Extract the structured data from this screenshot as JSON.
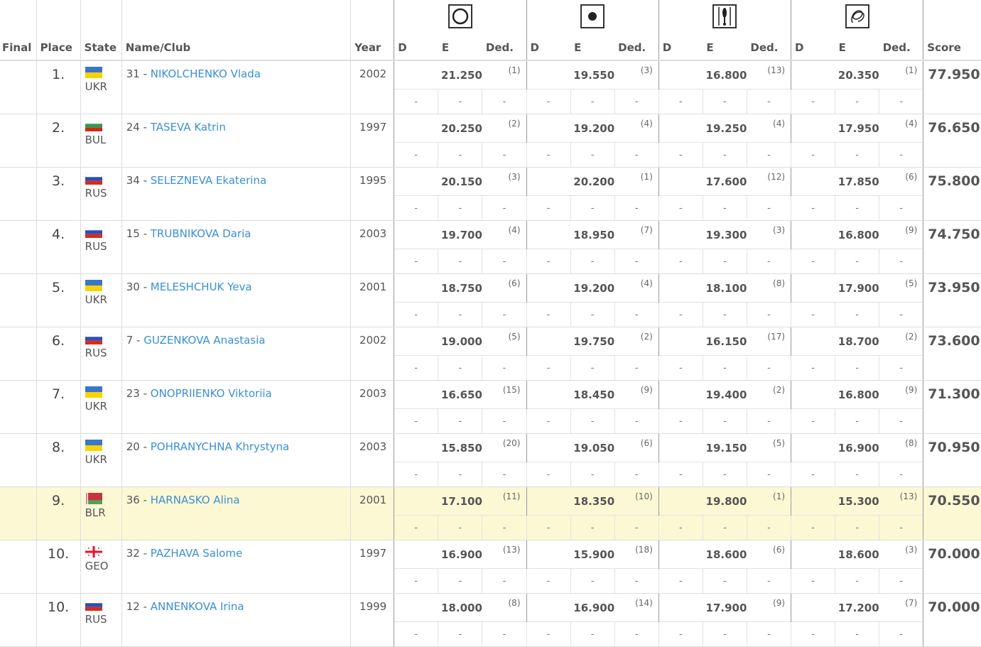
{
  "header": {
    "final": "Final",
    "place": "Place",
    "state": "State",
    "name_club": "Name/Club",
    "year": "Year",
    "score": "Score",
    "sub_d": "D",
    "sub_e": "E",
    "sub_ded": "Ded.",
    "apparatus_icons": [
      "hoop-icon",
      "ball-icon",
      "clubs-icon",
      "ribbon-icon"
    ]
  },
  "rows": [
    {
      "place": "1.",
      "country": "UKR",
      "flag": "ukraine-flag-icon",
      "num": "31 - ",
      "name": "NIKOLCHENKO Vlada",
      "year": "2002",
      "app": [
        [
          "21.250",
          "(1)"
        ],
        [
          "19.550",
          "(3)"
        ],
        [
          "16.800",
          "(13)"
        ],
        [
          "20.350",
          "(1)"
        ]
      ],
      "score": "77.950"
    },
    {
      "place": "2.",
      "country": "BUL",
      "flag": "bulgaria-flag-icon",
      "num": "24 - ",
      "name": "TASEVA Katrin",
      "year": "1997",
      "app": [
        [
          "20.250",
          "(2)"
        ],
        [
          "19.200",
          "(4)"
        ],
        [
          "19.250",
          "(4)"
        ],
        [
          "17.950",
          "(4)"
        ]
      ],
      "score": "76.650"
    },
    {
      "place": "3.",
      "country": "RUS",
      "flag": "russia-flag-icon",
      "num": "34 - ",
      "name": "SELEZNEVA Ekaterina",
      "year": "1995",
      "app": [
        [
          "20.150",
          "(3)"
        ],
        [
          "20.200",
          "(1)"
        ],
        [
          "17.600",
          "(12)"
        ],
        [
          "17.850",
          "(6)"
        ]
      ],
      "score": "75.800"
    },
    {
      "place": "4.",
      "country": "RUS",
      "flag": "russia-flag-icon",
      "num": "15 - ",
      "name": "TRUBNIKOVA Daria",
      "year": "2003",
      "app": [
        [
          "19.700",
          "(4)"
        ],
        [
          "18.950",
          "(7)"
        ],
        [
          "19.300",
          "(3)"
        ],
        [
          "16.800",
          "(9)"
        ]
      ],
      "score": "74.750"
    },
    {
      "place": "5.",
      "country": "UKR",
      "flag": "ukraine-flag-icon",
      "num": "30 - ",
      "name": "MELESHCHUK Yeva",
      "year": "2001",
      "app": [
        [
          "18.750",
          "(6)"
        ],
        [
          "19.200",
          "(4)"
        ],
        [
          "18.100",
          "(8)"
        ],
        [
          "17.900",
          "(5)"
        ]
      ],
      "score": "73.950"
    },
    {
      "place": "6.",
      "country": "RUS",
      "flag": "russia-flag-icon",
      "num": "7 - ",
      "name": "GUZENKOVA Anastasia",
      "year": "2002",
      "app": [
        [
          "19.000",
          "(5)"
        ],
        [
          "19.750",
          "(2)"
        ],
        [
          "16.150",
          "(17)"
        ],
        [
          "18.700",
          "(2)"
        ]
      ],
      "score": "73.600"
    },
    {
      "place": "7.",
      "country": "UKR",
      "flag": "ukraine-flag-icon",
      "num": "23 - ",
      "name": "ONOPRIIENKO Viktoriia",
      "year": "2003",
      "app": [
        [
          "16.650",
          "(15)"
        ],
        [
          "18.450",
          "(9)"
        ],
        [
          "19.400",
          "(2)"
        ],
        [
          "16.800",
          "(9)"
        ]
      ],
      "score": "71.300"
    },
    {
      "place": "8.",
      "country": "UKR",
      "flag": "ukraine-flag-icon",
      "num": "20 - ",
      "name": "POHRANYCHNA Khrystyna",
      "year": "2003",
      "app": [
        [
          "15.850",
          "(20)"
        ],
        [
          "19.050",
          "(6)"
        ],
        [
          "19.150",
          "(5)"
        ],
        [
          "16.900",
          "(8)"
        ]
      ],
      "score": "70.950"
    },
    {
      "place": "9.",
      "country": "BLR",
      "flag": "belarus-flag-icon",
      "num": "36 - ",
      "name": "HARNASKO Alina",
      "year": "2001",
      "app": [
        [
          "17.100",
          "(11)"
        ],
        [
          "18.350",
          "(10)"
        ],
        [
          "19.800",
          "(1)"
        ],
        [
          "15.300",
          "(13)"
        ]
      ],
      "score": "70.550",
      "highlight": true
    },
    {
      "place": "10.",
      "country": "GEO",
      "flag": "georgia-flag-icon",
      "num": "32 - ",
      "name": "PAZHAVA Salome",
      "year": "1997",
      "app": [
        [
          "16.900",
          "(13)"
        ],
        [
          "15.900",
          "(18)"
        ],
        [
          "18.600",
          "(6)"
        ],
        [
          "18.600",
          "(3)"
        ]
      ],
      "score": "70.000"
    },
    {
      "place": "10.",
      "country": "RUS",
      "flag": "russia-flag-icon",
      "num": "12 - ",
      "name": "ANNENKOVA Irina",
      "year": "1999",
      "app": [
        [
          "18.000",
          "(8)"
        ],
        [
          "16.900",
          "(14)"
        ],
        [
          "17.900",
          "(9)"
        ],
        [
          "17.200",
          "(7)"
        ]
      ],
      "score": "70.000"
    }
  ],
  "dash": "-",
  "colors": {
    "link": "#3a8fd6",
    "highlight": "#fdf8d4"
  }
}
